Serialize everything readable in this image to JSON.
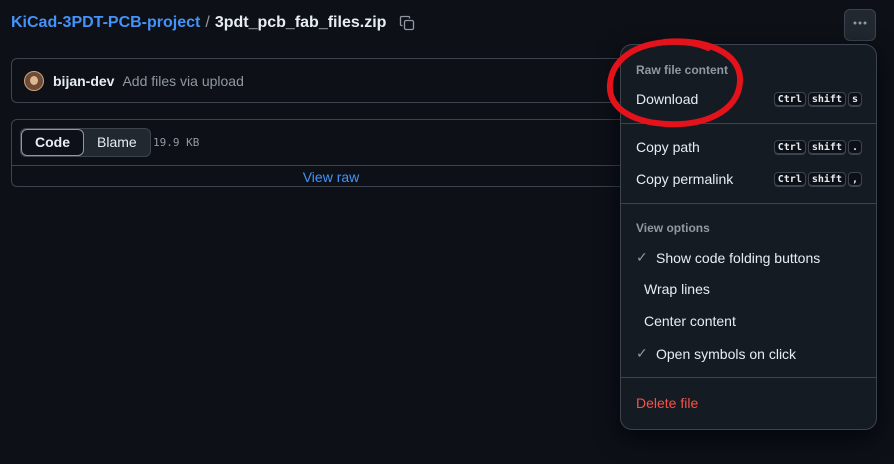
{
  "breadcrumb": {
    "repo": "KiCad-3PDT-PCB-project",
    "separator": "/",
    "file": "3pdt_pcb_fab_files.zip"
  },
  "icons": {
    "copy": "copy-icon",
    "more": "kebab-horizontal-icon",
    "check": "check-icon"
  },
  "commit": {
    "author": "bijan-dev",
    "message": "Add files via upload"
  },
  "file_view": {
    "tabs": [
      "Code",
      "Blame"
    ],
    "active_tab": "Code",
    "size": "19.9 KB",
    "view_raw": "View raw"
  },
  "menu": {
    "section1_title": "Raw file content",
    "download": {
      "label": "Download",
      "keys": [
        "Ctrl",
        "shift",
        "s"
      ]
    },
    "copy_path": {
      "label": "Copy path",
      "keys": [
        "Ctrl",
        "shift",
        "."
      ]
    },
    "copy_permalink": {
      "label": "Copy permalink",
      "keys": [
        "Ctrl",
        "shift",
        ","
      ]
    },
    "section2_title": "View options",
    "options": [
      {
        "label": "Show code folding buttons",
        "checked": true
      },
      {
        "label": "Wrap lines",
        "checked": false
      },
      {
        "label": "Center content",
        "checked": false
      },
      {
        "label": "Open symbols on click",
        "checked": true
      }
    ],
    "delete": "Delete file"
  },
  "colors": {
    "background": "#0d1117",
    "link": "#4493f8",
    "danger": "#f85149",
    "annotation": "#e3121b"
  }
}
